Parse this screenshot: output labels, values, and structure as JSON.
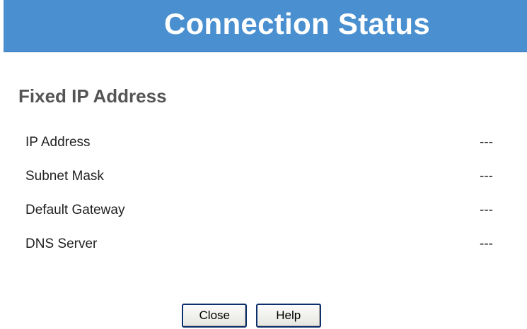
{
  "header": {
    "title": "Connection Status",
    "background_color": "#4a90d0"
  },
  "section": {
    "title": "Fixed IP Address"
  },
  "rows": [
    {
      "label": "IP Address",
      "value": "---"
    },
    {
      "label": "Subnet Mask",
      "value": "---"
    },
    {
      "label": "Default Gateway",
      "value": "---"
    },
    {
      "label": "DNS Server",
      "value": "---"
    }
  ],
  "buttons": {
    "close_label": "Close",
    "help_label": "Help"
  }
}
